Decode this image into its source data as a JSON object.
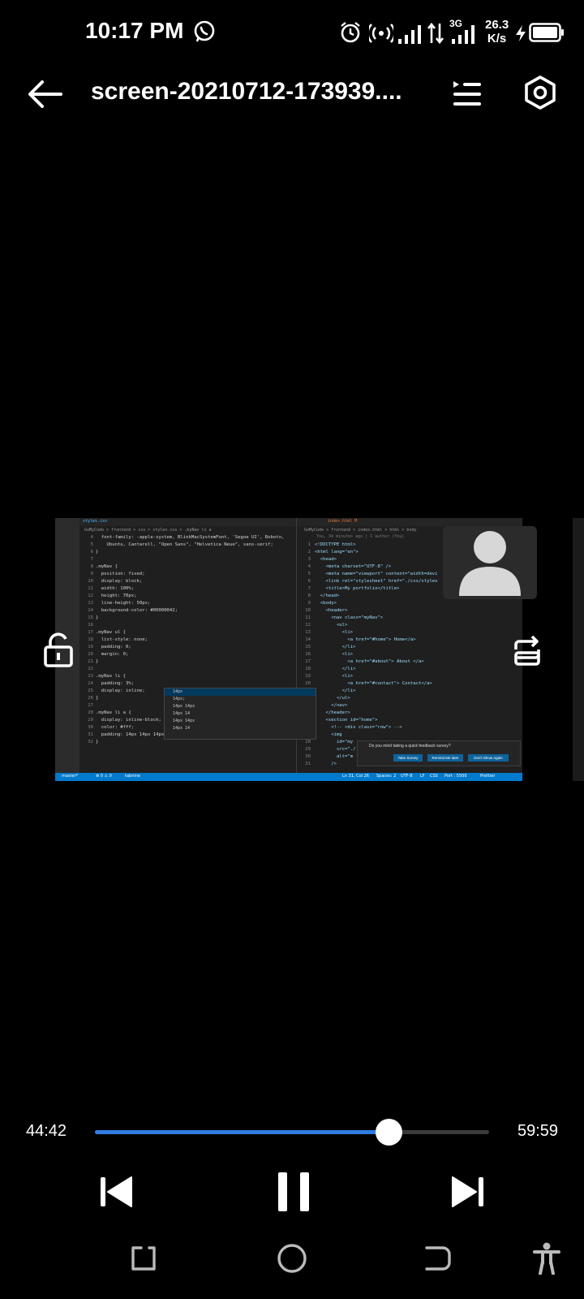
{
  "status_bar": {
    "time": "10:17 PM",
    "net_speed_value": "26.3",
    "net_speed_unit": "K/s",
    "network_label": "3G",
    "icons": [
      "whatsapp-icon",
      "alarm-icon",
      "hotspot-icon",
      "signal-icon",
      "data-arrows-icon",
      "signal-3g-icon",
      "charging-icon",
      "battery-icon"
    ]
  },
  "header": {
    "title": "screen-20210712-173939....",
    "icons": [
      "back-arrow-icon",
      "playlist-icon",
      "settings-icon"
    ]
  },
  "video": {
    "editor_tabs": [
      "styles.css",
      "index.html M"
    ],
    "left_breadcrumb": "GoMyCode > frontend > css > styles.css > .myNav li a",
    "right_breadcrumb": "GoMyCode > frontend > index.html > html > body",
    "git_blame": "You, 34 minutes ago | 1 author (You)",
    "left_code": [
      "  font-family: -apple-system, BlinkMacSystemFont, 'Segoe UI', Roboto,",
      "    Ubuntu, Cantarell, \"Open Sans\", \"Helvetica Neue\", sans-serif;",
      "}",
      "",
      ".myNav {",
      "  position: fixed;",
      "  display: block;",
      "  width: 100%;",
      "  height: 70px;",
      "  line-height: 50px;",
      "  background-color: #00000042;",
      "}",
      "",
      ".myNav ul {",
      "  list-style: none;",
      "  padding: 0;",
      "  margin: 0;",
      "}",
      "",
      ".myNav li {",
      "  padding: 3%;",
      "  display: inline;",
      "}",
      "",
      ".myNav li a {",
      "  display: inline-block;",
      "  color: #fff;",
      "  padding: 14px 14px 14px;",
      "}"
    ],
    "left_line_numbers": [
      "4",
      "5",
      "6",
      "7",
      "8",
      "9",
      "10",
      "11",
      "12",
      "13",
      "14",
      "15",
      "16",
      "17",
      "18",
      "19",
      "20",
      "21",
      "22",
      "23",
      "24",
      "25",
      "26",
      "27",
      "28",
      "29",
      "30",
      "31",
      "32"
    ],
    "right_code": [
      "<!DOCTYPE html>",
      "<html lang=\"en\">",
      "  <head>",
      "    <meta charset=\"UTF-8\" />",
      "    <meta name=\"viewport\" content=\"width=devi",
      "    <link rel=\"stylesheet\" href=\"./css/styles",
      "    <title>My portfolio</title>",
      "  </head>",
      "  <body>",
      "    <header>",
      "      <nav class=\"myNav\">",
      "        <ul>",
      "          <li>",
      "            <a href=\"#home\"> Home</a>",
      "          </li>",
      "          <li>",
      "            <a href=\"#about\"> About </a>",
      "          </li>",
      "          <li>",
      "            <a href=\"#contact\"> Contact</a>",
      "          </li>",
      "        </ul>",
      "      </nav>",
      "    </header>",
      "    <section id=\"home\">",
      "      <!-- <div class=\"row\"> -->",
      "      <img",
      "        id=\"my",
      "        src=\"./",
      "        alt=\"m",
      "      />"
    ],
    "right_line_numbers": [
      "1",
      "2",
      "3",
      "4",
      "5",
      "6",
      "7",
      "8",
      "9",
      "10",
      "11",
      "12",
      "13",
      "14",
      "15",
      "16",
      "17",
      "18",
      "19",
      "20",
      "21",
      "22",
      "23",
      "24",
      "25",
      "26",
      "27",
      "28",
      "29",
      "30",
      "31"
    ],
    "autocomplete": [
      "14px",
      "14px;",
      "14px 14px",
      "14px 14",
      "14px 14px",
      "14px 14"
    ],
    "survey": {
      "text": "Do you mind taking a quick feedback survey?",
      "buttons": [
        "Take Survey",
        "Remind Me later",
        "Don't Show Again"
      ]
    },
    "status_left": [
      "master*",
      "⊗ 0 ⚠ 0",
      "tabnine"
    ],
    "status_right": [
      "Ln 31, Col 26",
      "Spaces: 2",
      "UTF-8",
      "LF",
      "CSS",
      "Port : 5500",
      "Prettier"
    ]
  },
  "player": {
    "current_time": "44:42",
    "duration": "59:59",
    "progress_fraction": 0.745,
    "accent": "#2f7de1"
  },
  "controls": [
    "previous-icon",
    "pause-icon",
    "next-icon",
    "lock-icon",
    "rotate-icon"
  ],
  "nav_bar": [
    "recent-apps-icon",
    "home-icon",
    "back-icon",
    "accessibility-icon"
  ]
}
